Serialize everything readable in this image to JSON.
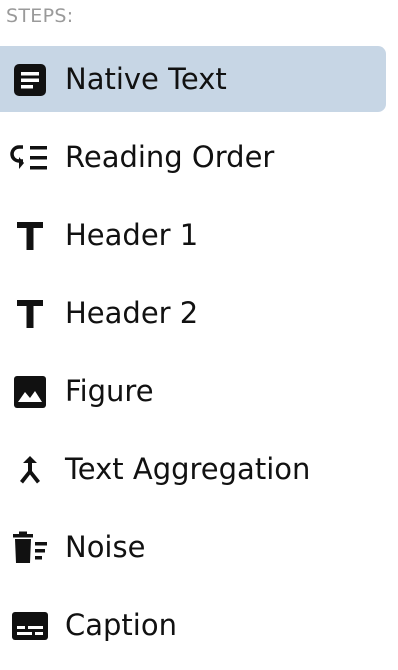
{
  "steps": {
    "heading": "STEPS:",
    "items": [
      {
        "label": "Native Text",
        "icon": "native-text-icon",
        "active": true
      },
      {
        "label": "Reading Order",
        "icon": "reading-order-icon",
        "active": false
      },
      {
        "label": "Header 1",
        "icon": "header-icon",
        "active": false
      },
      {
        "label": "Header 2",
        "icon": "header-icon",
        "active": false
      },
      {
        "label": "Figure",
        "icon": "figure-icon",
        "active": false
      },
      {
        "label": "Text Aggregation",
        "icon": "merge-icon",
        "active": false
      },
      {
        "label": "Noise",
        "icon": "noise-icon",
        "active": false
      },
      {
        "label": "Caption",
        "icon": "caption-icon",
        "active": false
      }
    ]
  },
  "colors": {
    "active_background": "#c7d6e5",
    "heading_text": "#9a9a9a",
    "item_text": "#111111"
  }
}
